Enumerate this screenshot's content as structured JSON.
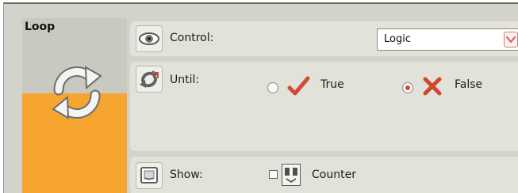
{
  "block": {
    "title": "Loop",
    "icon": "loop-arrows-icon"
  },
  "control": {
    "icon": "eye-icon",
    "label": "Control:",
    "selected": "Logic",
    "options": [
      "Logic"
    ]
  },
  "until": {
    "icon": "loop-until-icon",
    "label": "Until:",
    "true_label": "True",
    "false_label": "False",
    "selected": "False",
    "true_icon": "check-icon",
    "false_icon": "cross-icon"
  },
  "show": {
    "icon": "display-icon",
    "label": "Show:",
    "counter_label": "Counter",
    "counter_checked": false,
    "counter_icon": "counter-icon"
  },
  "colors": {
    "panel_bg": "#d3d3cb",
    "row_bg": "#e2e2db",
    "block_orange": "#f6a531",
    "accent_red": "#d34634"
  }
}
